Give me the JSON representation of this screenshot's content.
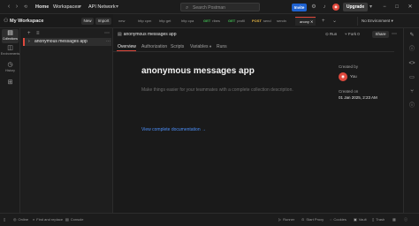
{
  "topbar": {
    "home": "Home",
    "workspaces": "Workspaces",
    "api_network": "API Network",
    "search_placeholder": "Search Postman",
    "invite": "Invite",
    "upgrade": "Upgrade"
  },
  "workspace": {
    "name": "My Workspace",
    "new_btn": "New",
    "import_btn": "Import"
  },
  "rail": {
    "collections": "Collections",
    "environments": "Environments",
    "history": "History"
  },
  "sidebar": {
    "collection_name": "anonymous messages app"
  },
  "tabs": [
    {
      "method": "",
      "label": "new"
    },
    {
      "method": "",
      "label": "http cpm"
    },
    {
      "method": "",
      "label": "http get"
    },
    {
      "method": "",
      "label": "http cpa"
    },
    {
      "method": "GET",
      "label": "ribes"
    },
    {
      "method": "GET",
      "label": "profil"
    },
    {
      "method": "POST",
      "label": "send"
    },
    {
      "method": "",
      "label": "sendn"
    },
    {
      "method": "",
      "label": "anony"
    }
  ],
  "env": {
    "label": "No Environment"
  },
  "main": {
    "breadcrumb": "anonymous messages app",
    "run": "Run",
    "fork": "Fork",
    "fork_count": "0",
    "share": "Share",
    "subtabs": {
      "overview": "Overview",
      "authorization": "Authorization",
      "scripts": "Scripts",
      "variables": "Variables",
      "runs": "Runs"
    },
    "title": "anonymous messages app",
    "description": "Make things easier for your teammates with a complete collection description.",
    "doc_link": "View complete documentation →",
    "created_by_label": "Created by",
    "created_by_user": "You",
    "created_on_label": "Created on",
    "created_on_value": "01 Jan 2025, 2:23 AM"
  },
  "statusbar": {
    "online": "Online",
    "find_replace": "Find and replace",
    "console": "Console",
    "runner": "Runner",
    "start_proxy": "Start Proxy",
    "cookies": "Cookies",
    "vault": "Vault",
    "trash": "Trash"
  },
  "colors": {
    "accent": "#e0493d",
    "invite_blue": "#1f62d0",
    "link_blue": "#4b8ef7",
    "background": "#1a1a1a"
  },
  "icons": [
    "back-icon",
    "forward-icon",
    "search-icon",
    "settings-icon",
    "bell-icon",
    "grid-icon",
    "minimize-icon",
    "maximize-icon",
    "close-icon"
  ]
}
